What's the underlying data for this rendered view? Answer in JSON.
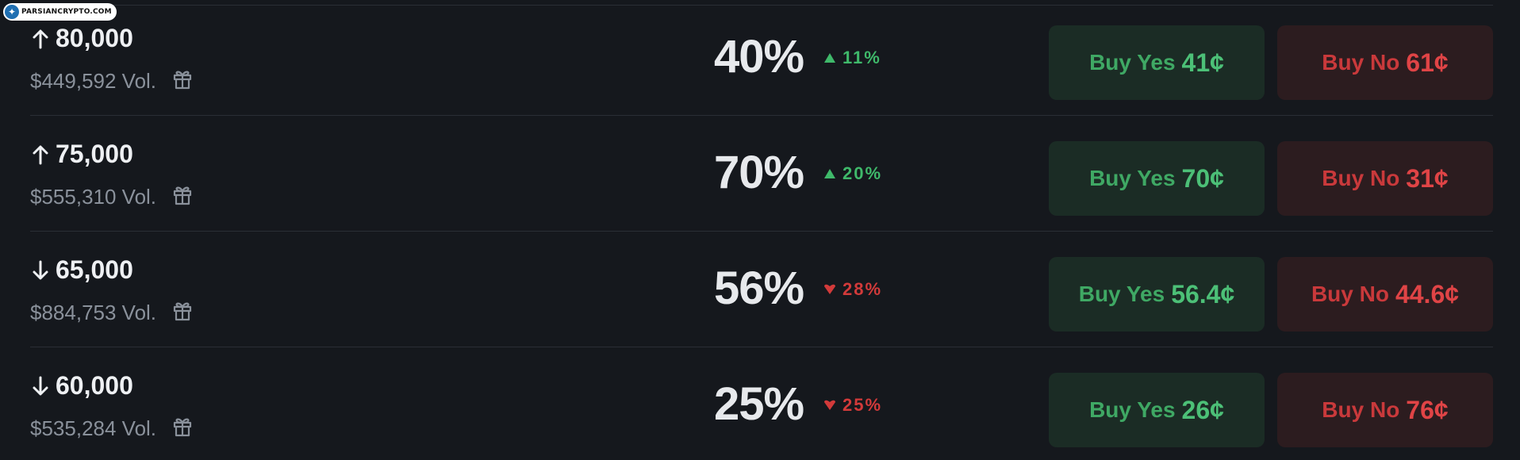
{
  "watermark": "PARSIANCRYPTO.COM",
  "colors": {
    "background": "#15181d",
    "up": "#3fb96a",
    "down": "#d23a3a",
    "yes_bg": "#1b2c25",
    "no_bg": "#2c1c1f"
  },
  "markets": [
    {
      "direction": "up",
      "title": "80,000",
      "volume": "$449,592 Vol.",
      "probability": "40%",
      "change_direction": "up",
      "change": "11%",
      "yes_label": "Buy Yes",
      "yes_price": "41¢",
      "no_label": "Buy No",
      "no_price": "61¢"
    },
    {
      "direction": "up",
      "title": "75,000",
      "volume": "$555,310 Vol.",
      "probability": "70%",
      "change_direction": "up",
      "change": "20%",
      "yes_label": "Buy Yes",
      "yes_price": "70¢",
      "no_label": "Buy No",
      "no_price": "31¢"
    },
    {
      "direction": "down",
      "title": "65,000",
      "volume": "$884,753 Vol.",
      "probability": "56%",
      "change_direction": "down",
      "change": "28%",
      "yes_label": "Buy Yes",
      "yes_price": "56.4¢",
      "no_label": "Buy No",
      "no_price": "44.6¢"
    },
    {
      "direction": "down",
      "title": "60,000",
      "volume": "$535,284 Vol.",
      "probability": "25%",
      "change_direction": "down",
      "change": "25%",
      "yes_label": "Buy Yes",
      "yes_price": "26¢",
      "no_label": "Buy No",
      "no_price": "76¢"
    }
  ]
}
